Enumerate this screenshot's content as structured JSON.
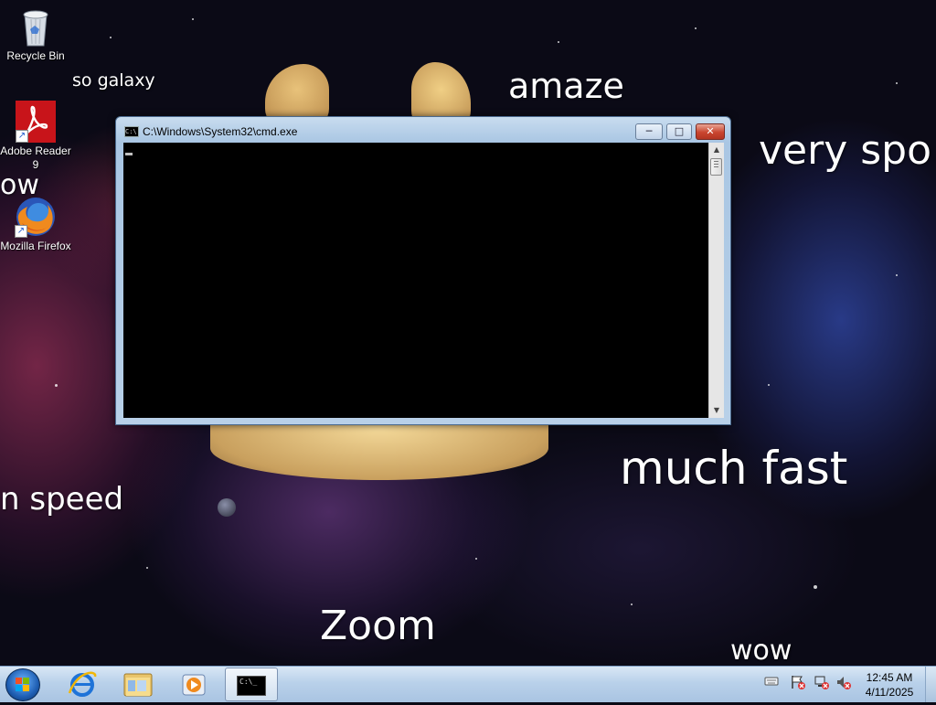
{
  "desktop": {
    "icons": [
      {
        "label": "Recycle Bin"
      },
      {
        "label": "Adobe Reader 9"
      },
      {
        "label": "Mozilla Firefox"
      }
    ],
    "wallpaper_text": {
      "so_galaxy": "so galaxy",
      "amaze": "amaze",
      "very_spo": "very spo",
      "ow": "ow",
      "much_fast": "much fast",
      "n_speed": "n speed",
      "zoom": "Zoom",
      "wow": "wow"
    }
  },
  "cmd_window": {
    "title": "C:\\Windows\\System32\\cmd.exe",
    "icon_text": "C:\\",
    "buttons": {
      "minimize": "─",
      "maximize": "□",
      "close": "✕"
    },
    "scroll_up": "▲",
    "scroll_down": "▼"
  },
  "taskbar": {
    "pinned": [
      {
        "name": "internet-explorer"
      },
      {
        "name": "windows-explorer"
      },
      {
        "name": "windows-media-player"
      },
      {
        "name": "command-prompt",
        "active": true,
        "icon_text": "C:\\_"
      }
    ],
    "tray_icons": [
      "keyboard-icon",
      "action-center-icon",
      "network-icon",
      "volume-muted-icon"
    ],
    "clock": {
      "time": "12:45 AM",
      "date": "4/11/2025"
    }
  },
  "colors": {
    "taskbar": "#b9d1ea",
    "console_bg": "#000000",
    "close_button": "#c9452f",
    "window_frame": "#a9c6e3"
  }
}
